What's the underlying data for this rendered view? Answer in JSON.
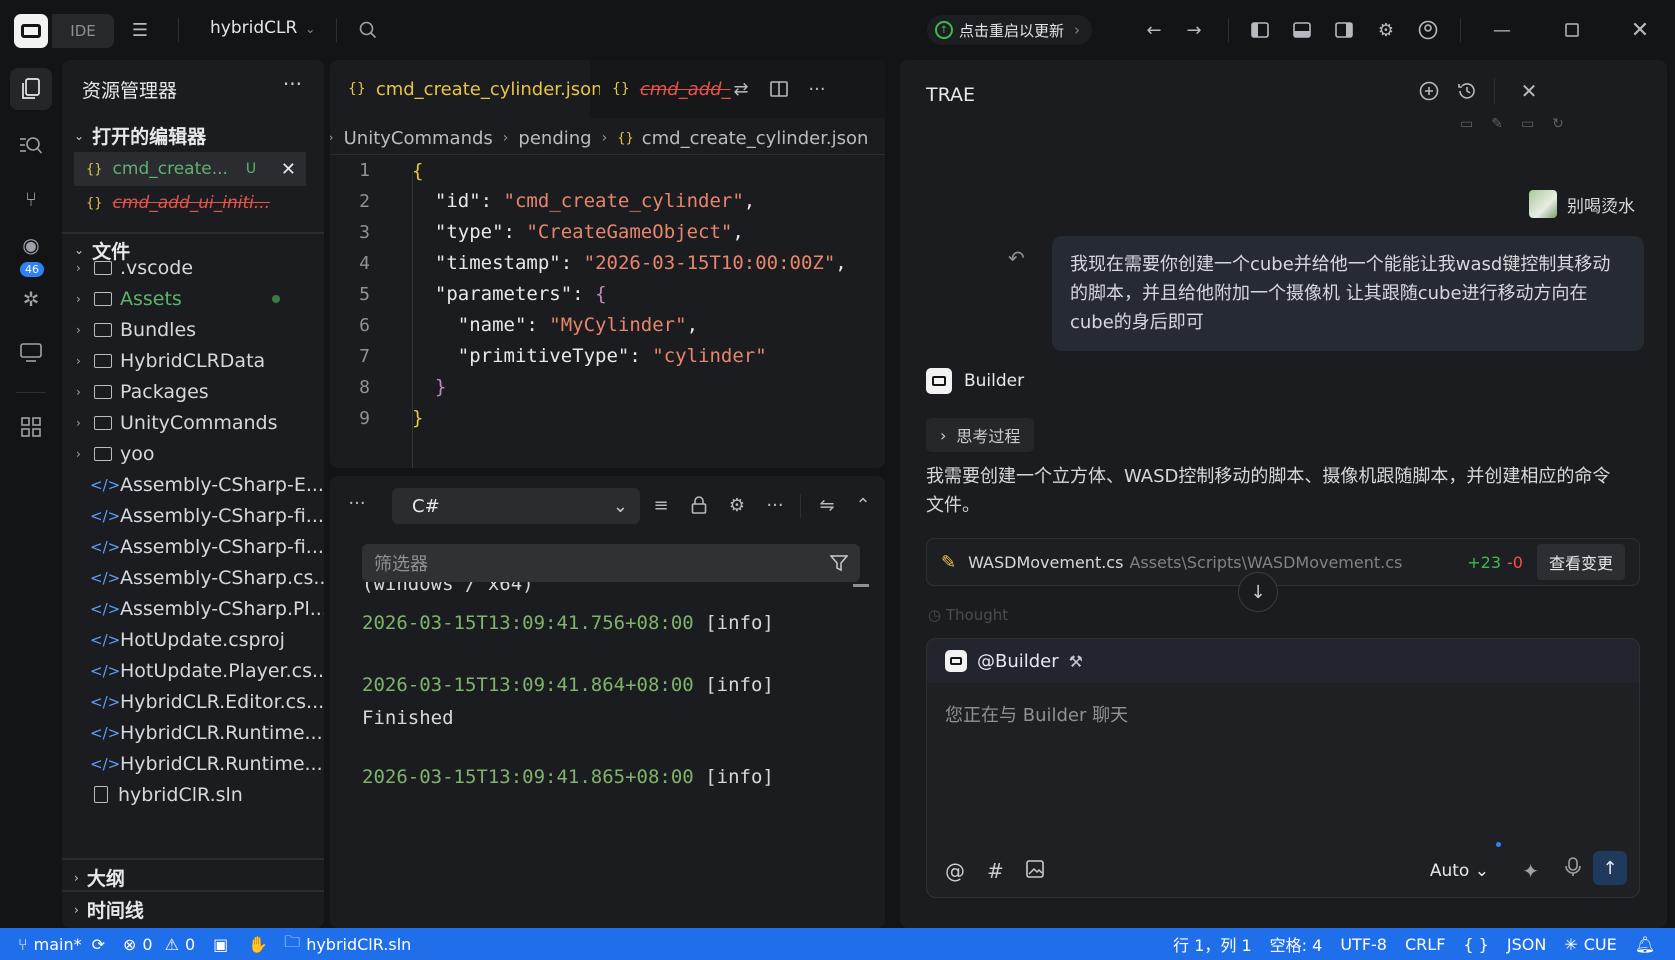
{
  "titlebar": {
    "ide_label": "IDE",
    "project": "hybridCLR",
    "update_text": "点击重启以更新"
  },
  "activity": {
    "badge": "46"
  },
  "explorer": {
    "title": "资源管理器",
    "open_editors_title": "打开的编辑器",
    "open_editors": [
      {
        "name": "cmd_create...",
        "status": "U"
      },
      {
        "name": "cmd_add_ui_initi..."
      }
    ],
    "files_title": "文件",
    "folders": [
      ".vscode",
      "Assets",
      "Bundles",
      "HybridCLRData",
      "Packages",
      "UnityCommands",
      "yoo"
    ],
    "code_files": [
      "Assembly-CSharp-E...",
      "Assembly-CSharp-fi...",
      "Assembly-CSharp-fi...",
      "Assembly-CSharp.cs...",
      "Assembly-CSharp.Pl...",
      "HotUpdate.csproj",
      "HotUpdate.Player.cs...",
      "HybridCLR.Editor.cs...",
      "HybridCLR.Runtime...",
      "HybridCLR.Runtime..."
    ],
    "sln_file": "hybridClR.sln",
    "outline_title": "大纲",
    "timeline_title": "时间线"
  },
  "editor": {
    "tabs": [
      {
        "label": "cmd_create_cylinder.json"
      },
      {
        "label": "cmd_add_"
      }
    ],
    "breadcrumb": [
      "UnityCommands",
      "pending",
      "cmd_create_cylinder.json"
    ],
    "line_numbers": [
      "1",
      "2",
      "3",
      "4",
      "5",
      "6",
      "7",
      "8",
      "9"
    ],
    "code": {
      "l1": "{",
      "l2_key": "\"id\"",
      "l2_val": "\"cmd_create_cylinder\"",
      "l3_key": "\"type\"",
      "l3_val": "\"CreateGameObject\"",
      "l4_key": "\"timestamp\"",
      "l4_val": "\"2026-03-15T10:00:00Z\"",
      "l5_key": "\"parameters\"",
      "l5_val": "{",
      "l6_key": "\"name\"",
      "l6_val": "\"MyCylinder\"",
      "l7_key": "\"primitiveType\"",
      "l7_val": "\"cylinder\"",
      "l8": "}",
      "l9": "}"
    }
  },
  "output": {
    "language": "C#",
    "filter_placeholder": "筛选器",
    "partial_line": "(windows / x64)",
    "logs": [
      {
        "ts": "2026-03-15T13:09:41.756+08:00",
        "level": "[info]"
      },
      {
        "ts": "2026-03-15T13:09:41.864+08:00",
        "level": "[info]",
        "message": "Finished"
      },
      {
        "ts": "2026-03-15T13:09:41.865+08:00",
        "level": "[info]"
      }
    ]
  },
  "ai": {
    "title": "TRAE",
    "user_name": "别喝烫水",
    "user_message": "我现在需要你创建一个cube并给他一个能能让我wasd键控制其移动的脚本，并且给他附加一个摄像机 让其跟随cube进行移动方向在cube的身后即可",
    "agent_name": "Builder",
    "thinking_label": "思考过程",
    "response": "我需要创建一个立方体、WASD控制移动的脚本、摄像机跟随脚本，并创建相应的命令文件。",
    "file_card": {
      "file_name": "WASDMovement.cs",
      "file_path": "Assets\\Scripts\\WASDMovement.cs",
      "additions": "+23",
      "deletions": "-0",
      "view_label": "查看变更"
    },
    "thought_faint": "Thought",
    "input": {
      "mention": "@Builder",
      "placeholder": "您正在与 Builder 聊天",
      "mode": "Auto"
    }
  },
  "statusbar": {
    "branch": "main*",
    "errors": "0",
    "warnings": "0",
    "solution": "hybridClR.sln",
    "position": "行 1，列 1",
    "spaces": "空格: 4",
    "encoding": "UTF-8",
    "eol": "CRLF",
    "language": "JSON",
    "extension": "CUE"
  },
  "colors": {
    "accent": "#1f6feb",
    "string": "#e8866b",
    "bracket": "#e7c547",
    "timestamp": "#7fb36b"
  }
}
